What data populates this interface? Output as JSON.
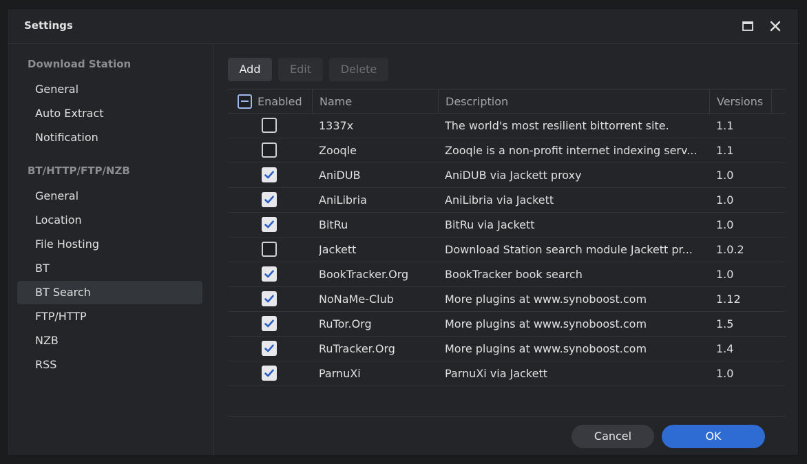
{
  "window": {
    "title": "Settings"
  },
  "sidebar": {
    "sections": [
      {
        "title": "Download Station",
        "items": [
          "General",
          "Auto Extract",
          "Notification"
        ]
      },
      {
        "title": "BT/HTTP/FTP/NZB",
        "items": [
          "General",
          "Location",
          "File Hosting",
          "BT",
          "BT Search",
          "FTP/HTTP",
          "NZB",
          "RSS"
        ]
      }
    ],
    "selected": "BT Search"
  },
  "toolbar": {
    "add": "Add",
    "edit": "Edit",
    "delete": "Delete"
  },
  "table": {
    "columns": [
      "Enabled",
      "Name",
      "Description",
      "Versions"
    ],
    "rows": [
      {
        "enabled": false,
        "name": "1337x",
        "description": "The world's most resilient bittorrent site.",
        "version": "1.1"
      },
      {
        "enabled": false,
        "name": "Zooqle",
        "description": "Zooqle is a non-profit internet indexing serv...",
        "version": "1.1"
      },
      {
        "enabled": true,
        "name": "AniDUB",
        "description": "AniDUB via Jackett proxy",
        "version": "1.0"
      },
      {
        "enabled": true,
        "name": "AniLibria",
        "description": "AniLibria via Jackett",
        "version": "1.0"
      },
      {
        "enabled": true,
        "name": "BitRu",
        "description": "BitRu via Jackett",
        "version": "1.0"
      },
      {
        "enabled": false,
        "name": "Jackett",
        "description": "Download Station search module Jackett pr...",
        "version": "1.0.2"
      },
      {
        "enabled": true,
        "name": "BookTracker.Org",
        "description": "BookTracker book search",
        "version": "1.0"
      },
      {
        "enabled": true,
        "name": "NoNaMe-Club",
        "description": "More plugins at www.synoboost.com",
        "version": "1.12"
      },
      {
        "enabled": true,
        "name": "RuTor.Org",
        "description": "More plugins at www.synoboost.com",
        "version": "1.5"
      },
      {
        "enabled": true,
        "name": "RuTracker.Org",
        "description": "More plugins at www.synoboost.com",
        "version": "1.4"
      },
      {
        "enabled": true,
        "name": "ParnuXi",
        "description": "ParnuXi via Jackett",
        "version": "1.0"
      }
    ]
  },
  "footer": {
    "cancel": "Cancel",
    "ok": "OK"
  },
  "colors": {
    "accent": "#2e6bd2",
    "background": "#232528",
    "selected_nav": "#33363b",
    "checkbox_highlight": "#9fb8ea"
  }
}
